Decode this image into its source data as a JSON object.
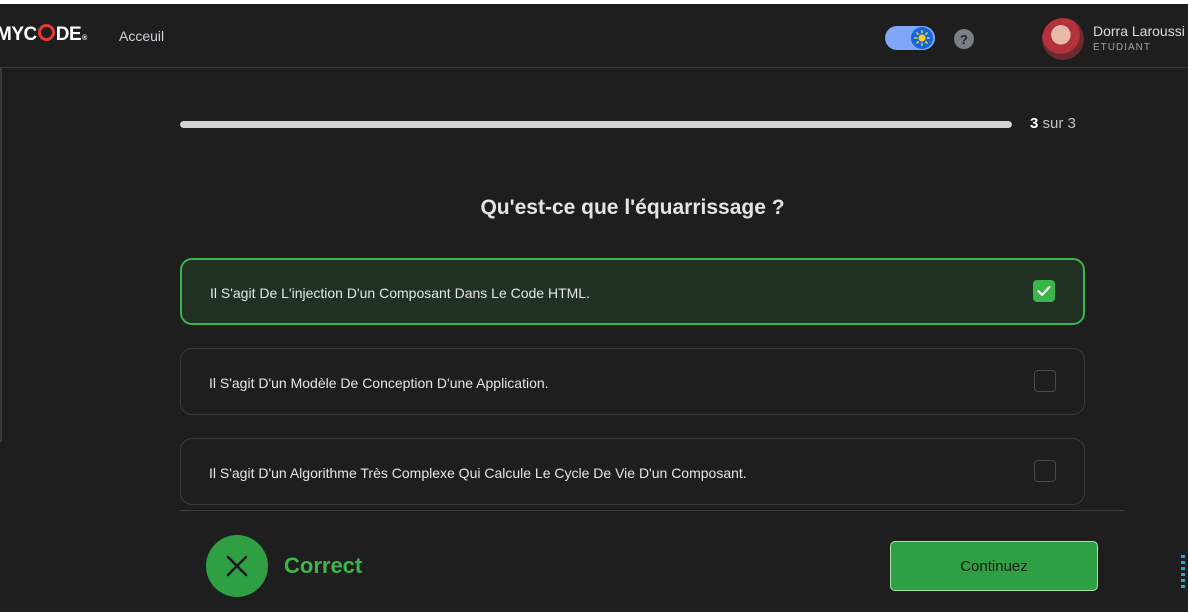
{
  "header": {
    "logo_text": "MYCODE",
    "nav_home": "Acceuil",
    "theme_toggle": {
      "state": "on",
      "icon": "sun-icon",
      "color": "#7fa6f7"
    },
    "help_icon": "?",
    "user": {
      "name": "Dorra Laroussi",
      "role": "ETUDIANT"
    }
  },
  "quiz": {
    "progress": {
      "current": "3",
      "separator": "sur",
      "total": "3",
      "fraction": 1.0
    },
    "question": "Qu'est-ce que l'équarrissage ?",
    "options": [
      {
        "label": "Il S'agit De L'injection D'un Composant Dans Le Code HTML.",
        "selected": true
      },
      {
        "label": "Il S'agit D'un Modèle De Conception D'une Application.",
        "selected": false
      },
      {
        "label": "Il S'agit D'un Algorithme Très Complexe Qui Calcule Le Cycle De Vie D'un Composant.",
        "selected": false
      }
    ]
  },
  "footer": {
    "result_text": "Correct",
    "result_icon": "close-icon",
    "continue_label": "Continuez",
    "accent_color": "#2ea043"
  }
}
